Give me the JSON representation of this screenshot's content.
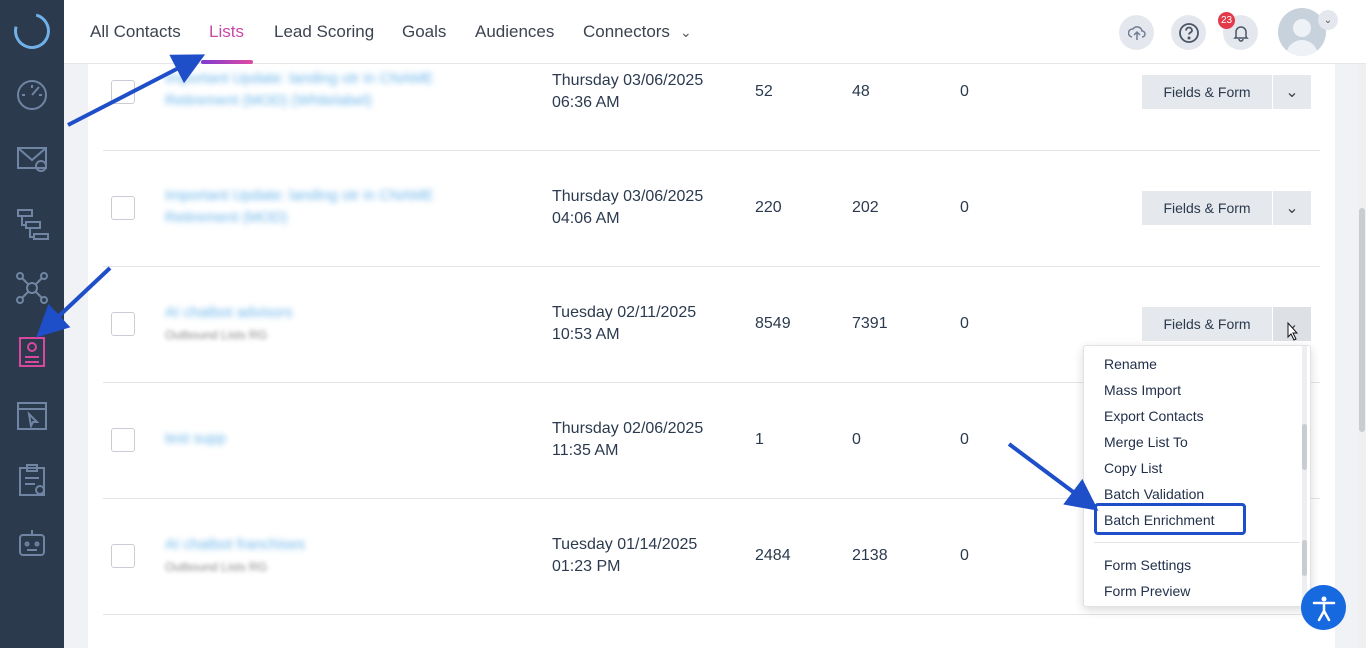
{
  "nav": {
    "tabs": [
      "All Contacts",
      "Lists",
      "Lead Scoring",
      "Goals",
      "Audiences",
      "Connectors"
    ],
    "active_tab": "Lists",
    "notification_count": "23"
  },
  "rows": [
    {
      "name": "Important Update: landing otr in CNAME Retirement (MOD) (Whitelabel)",
      "folder": "",
      "date": "Thursday 03/06/2025",
      "time": "06:36 AM",
      "c1": "52",
      "c2": "48",
      "c3": "0",
      "button": "Fields & Form"
    },
    {
      "name": "Important Update: landing otr in CNAME Retirement (MOD)",
      "folder": "",
      "date": "Thursday 03/06/2025",
      "time": "04:06 AM",
      "c1": "220",
      "c2": "202",
      "c3": "0",
      "button": "Fields & Form"
    },
    {
      "name": "AI chatbot advisors",
      "folder": "Outbound Lists RG",
      "date": "Tuesday 02/11/2025",
      "time": "10:53 AM",
      "c1": "8549",
      "c2": "7391",
      "c3": "0",
      "button": "Fields & Form"
    },
    {
      "name": "test supp",
      "folder": "",
      "date": "Thursday 02/06/2025",
      "time": "11:35 AM",
      "c1": "1",
      "c2": "0",
      "c3": "0",
      "button": ""
    },
    {
      "name": "AI chatbot franchises",
      "folder": "Outbound Lists RG",
      "date": "Tuesday 01/14/2025",
      "time": "01:23 PM",
      "c1": "2484",
      "c2": "2138",
      "c3": "0",
      "button": ""
    }
  ],
  "dropdown": {
    "items": [
      "Rename",
      "Mass Import",
      "Export Contacts",
      "Merge List To",
      "Copy List",
      "Batch Validation",
      "Batch Enrichment"
    ],
    "items_after": [
      "Form Settings",
      "Form Preview"
    ]
  },
  "colors": {
    "sidebar": "#2c3a4e",
    "accent": "#c74aa5",
    "annotation": "#1f4fc8"
  },
  "icons": [
    "speedometer-icon",
    "email-icon",
    "workflow-icon",
    "network-icon",
    "contacts-list-icon",
    "browser-icon",
    "clipboard-icon",
    "robot-icon",
    "upload-icon",
    "help-icon",
    "bell-icon",
    "accessibility-icon"
  ]
}
